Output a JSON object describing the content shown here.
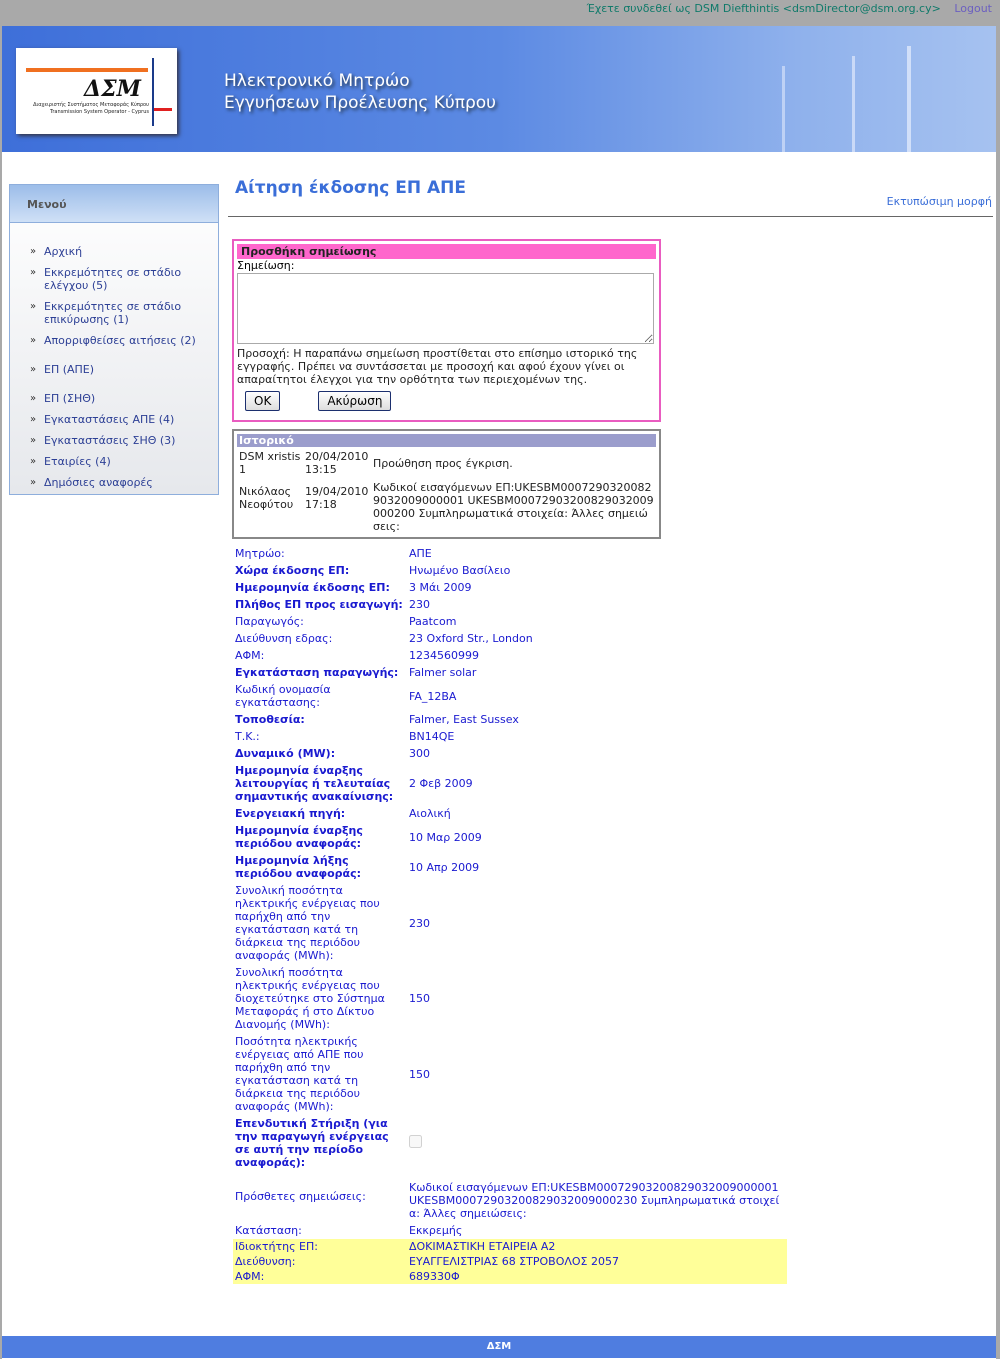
{
  "topbar": {
    "logged_in": "Έχετε συνδεθεί ως DSM Diefthintis <dsmDirector@dsm.org.cy>",
    "logout": "Logout"
  },
  "banner": {
    "logo_text": "ΔΣΜ",
    "logo_sub1": "Διαχειριστής Συστήματος Μεταφοράς Κύπρου",
    "logo_sub2": "Transmission System Operator - Cyprus",
    "title_line1": "Ηλεκτρονικό Μητρώο",
    "title_line2": "Εγγυήσεων Προέλευσης Κύπρου"
  },
  "sidebar": {
    "title": "Μενού",
    "items": [
      {
        "label": "Αρχική"
      },
      {
        "label": "Εκκρεμότητες σε στάδιο ελέγχου (5)"
      },
      {
        "label": "Εκκρεμότητες σε στάδιο επικύρωσης (1)"
      },
      {
        "label": "Απορριφθείσες αιτήσεις (2)"
      },
      {
        "label": "ΕΠ (ΑΠΕ)"
      },
      {
        "label": "ΕΠ (ΣΗΘ)"
      },
      {
        "label": "Εγκαταστάσεις ΑΠΕ (4)"
      },
      {
        "label": "Εγκαταστάσεις ΣΗΘ (3)"
      },
      {
        "label": "Εταιρίες (4)"
      },
      {
        "label": "Δημόσιες αναφορές"
      }
    ]
  },
  "main": {
    "title": "Αίτηση έκδοσης ΕΠ ΑΠΕ",
    "print_link": "Εκτυπώσιμη μορφή"
  },
  "note_box": {
    "title": "Προσθήκη σημείωσης",
    "label": "Σημείωση:",
    "value": "",
    "warning": "Προσοχή: Η παραπάνω σημείωση προστίθεται στο επίσημο ιστορικό της εγγραφής. Πρέπει να συντάσσεται με προσοχή και αφού έχουν γίνει οι απαραίτητοι έλεγχοι για την ορθότητα των περιεχομένων της.",
    "ok": "OK",
    "cancel": "Ακύρωση"
  },
  "history": {
    "title": "Ιστορικό",
    "entries": [
      {
        "user": "DSM xristis 1",
        "datetime": "20/04/2010 13:15",
        "text": "Προώθηση προς έγκριση."
      },
      {
        "user": "Νικόλαος Νεοφύτου",
        "datetime": "19/04/2010 17:18",
        "text": "Κωδικοί εισαγόμενων ΕΠ:UKESBM0007290320082903200900000​1 UKESBM00072903200829032009000200 Συμπληρωματικά στοιχεία: Άλλες σημειώσεις:"
      }
    ]
  },
  "fields": [
    {
      "label": "Μητρώο:",
      "value": "ΑΠΕ",
      "bold": false
    },
    {
      "label": "Χώρα έκδοσης ΕΠ:",
      "value": "Ηνωμένο Βασίλειο",
      "bold": true
    },
    {
      "label": "Ημερομηνία έκδοσης ΕΠ:",
      "value": "3 Μάι 2009",
      "bold": true
    },
    {
      "label": "Πλήθος ΕΠ προς εισαγωγή:",
      "value": "230",
      "bold": true
    },
    {
      "label": "Παραγωγός:",
      "value": "Paatcom",
      "bold": false
    },
    {
      "label": "Διεύθυνση εδρας:",
      "value": "23 Oxford Str., London",
      "bold": false
    },
    {
      "label": "ΑΦΜ:",
      "value": "1234560999",
      "bold": false
    },
    {
      "label": "Εγκατάσταση παραγωγής:",
      "value": "Falmer solar",
      "bold": true
    },
    {
      "label": "Κωδική ονομασία εγκατάστασης:",
      "value": "FA_12BA",
      "bold": false
    },
    {
      "label": "Τοποθεσία:",
      "value": "Falmer, East Sussex",
      "bold": true
    },
    {
      "label": "Τ.Κ.:",
      "value": "BN14QE",
      "bold": false
    },
    {
      "label": "Δυναμικό (MW):",
      "value": "300",
      "bold": true
    },
    {
      "label": "Ημερομηνία έναρξης λειτουργίας ή τελευταίας σημαντικής ανακαίνισης:",
      "value": "2 Φεβ 2009",
      "bold": true
    },
    {
      "label": "Ενεργειακή πηγή:",
      "value": "Αιολική",
      "bold": true
    },
    {
      "label": "Ημερομηνία έναρξης περιόδου αναφοράς:",
      "value": "10 Μαρ 2009",
      "bold": true
    },
    {
      "label": "Ημερομηνία λήξης περιόδου αναφοράς:",
      "value": "10 Απρ 2009",
      "bold": true
    },
    {
      "label": "Συνολική ποσότητα ηλεκτρικής ενέργειας που παρήχθη από την εγκατάσταση κατά τη διάρκεια της περιόδου αναφοράς (MWh):",
      "value": "230",
      "bold": false
    },
    {
      "label": "Συνολική ποσότητα ηλεκτρικής ενέργειας που διοχετεύτηκε στο Σύστημα Μεταφοράς ή στο Δίκτυο Διανομής (MWh):",
      "value": "150",
      "bold": false
    },
    {
      "label": "Ποσότητα ηλεκτρικής ενέργειας από ΑΠΕ που παρήχθη από την εγκατάσταση κατά τη διάρκεια της περιόδου αναφοράς (MWh):",
      "value": "150",
      "bold": false
    },
    {
      "label": "Επενδυτική Στήριξη (για την παραγωγή ενέργειας σε αυτή την περίοδο αναφοράς):",
      "checked": false,
      "bold": true
    },
    {
      "label": "Πρόσθετες σημειώσεις:",
      "value": "Κωδικοί εισαγόμενων ΕΠ:UKESBM00072903200829032009000001 UKESBM00072903200829032009000230 Συμπληρωματικά στοιχεία: Άλλες σημειώσεις:",
      "bold": false
    },
    {
      "label": "Κατάσταση:",
      "value": "Εκκρεμής",
      "bold": false
    }
  ],
  "owner": [
    {
      "label": "Ιδιοκτήτης ΕΠ:",
      "value": "ΔΟΚΙΜΑΣΤΙΚΗ ΕΤΑΙΡΕΙΑ Α2"
    },
    {
      "label": "Διεύθυνση:",
      "value": "ΕΥΑΓΓΕΛΙΣΤΡΙΑΣ 68 ΣΤΡΟΒΟΛΟΣ 2057"
    },
    {
      "label": "ΑΦΜ:",
      "value": "689330Φ"
    }
  ],
  "footer": {
    "text": "ΔΣΜ"
  },
  "colors": {
    "accent": "#3a6ed8",
    "note_header": "#ff66cc",
    "history_header": "#9b9dcc",
    "owner_highlight": "#ffff99",
    "footer": "#4f7de0"
  }
}
